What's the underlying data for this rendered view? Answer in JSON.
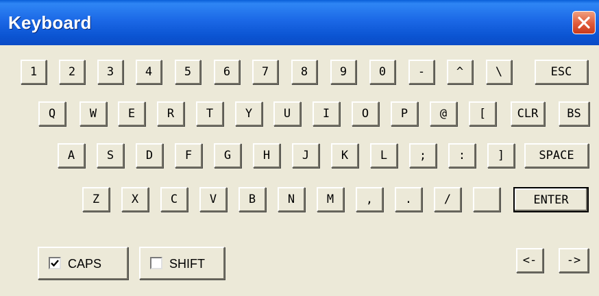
{
  "window": {
    "title": "Keyboard"
  },
  "keys": {
    "row1": [
      "1",
      "2",
      "3",
      "4",
      "5",
      "6",
      "7",
      "8",
      "9",
      "0",
      "-",
      "^",
      "\\",
      "ESC"
    ],
    "row2": [
      "Q",
      "W",
      "E",
      "R",
      "T",
      "Y",
      "U",
      "I",
      "O",
      "P",
      "@",
      "[",
      "CLR",
      "BS"
    ],
    "row3": [
      "A",
      "S",
      "D",
      "F",
      "G",
      "H",
      "J",
      "K",
      "L",
      ";",
      ":",
      "]",
      "SPACE"
    ],
    "row4": [
      "Z",
      "X",
      "C",
      "V",
      "B",
      "N",
      "M",
      ",",
      ".",
      "/",
      "",
      "ENTER"
    ]
  },
  "options": {
    "caps": {
      "label": "CAPS",
      "checked": true
    },
    "shift": {
      "label": "SHIFT",
      "checked": false
    }
  },
  "nav": {
    "left": "<-",
    "right": "->"
  },
  "icons": {
    "close": "close-icon",
    "check": "checkmark-icon"
  },
  "colors": {
    "titlebar": "#1b68e6",
    "close": "#e05a3a",
    "face": "#ece9d8"
  }
}
